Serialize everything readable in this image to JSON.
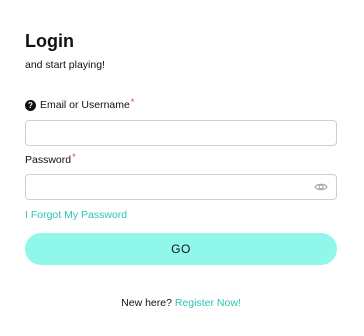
{
  "login": {
    "title": "Login",
    "subtitle": "and start playing!",
    "email_label": "Email or Username",
    "email_required_mark": "*",
    "email_value": "",
    "password_label": "Password",
    "password_required_mark": "*",
    "password_value": "",
    "forgot_link": "I Forgot My Password",
    "go_button": "GO",
    "footer_text": "New here?",
    "register_link": "Register Now!",
    "help_icon": "help-icon",
    "password_visibility_icon": "eye-icon"
  },
  "colors": {
    "accent_button": "#8ff8ea",
    "link": "#2bc4b0",
    "required": "#e53935",
    "input_border": "#cfcfcf"
  }
}
